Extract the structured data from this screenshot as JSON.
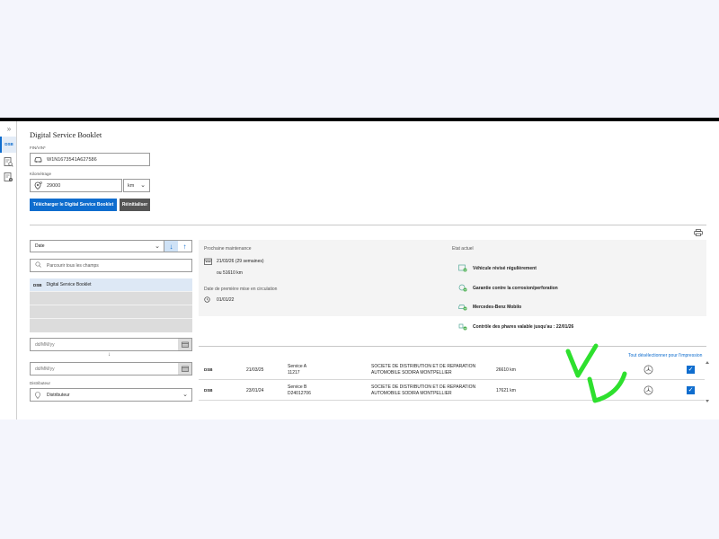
{
  "app": {
    "title": "Digital Service Booklet"
  },
  "rail": {
    "items": [
      {
        "label": "DSB",
        "icon": "dsb-icon"
      },
      {
        "icon": "document-search-icon"
      },
      {
        "icon": "document-settings-icon"
      }
    ]
  },
  "form": {
    "fin_label": "FIN/VIN*",
    "fin_value": "W1N1673541A627586",
    "mileage_label": "Kilométrage",
    "mileage_value": "29000",
    "unit_value": "km",
    "download_label": "Télécharger le Digital Service Booklet",
    "reset_label": "Réinitialiser"
  },
  "filters": {
    "sort_value": "Date",
    "search_placeholder": "Parcourir tous les champs",
    "list": [
      {
        "tag": "DSB",
        "label": "Digital Service Booklet"
      }
    ],
    "date_from_placeholder": "dd/MM/yy",
    "date_to_placeholder": "dd/MM/yy",
    "arrow": "↓",
    "distributor_label": "Distributeur",
    "distributor_value": "Distributeur"
  },
  "info": {
    "next_label": "Prochaine maintenance",
    "next_date": "21/03/26 (29 semaines)",
    "next_km": "ou 51610 km",
    "first_reg_label": "Date de première mise en circulation",
    "first_reg_value": "01/01/22",
    "state_label": "Etat actuel",
    "states": [
      "Véhicule révisé régulièrement",
      "Garantie contre la corrosion/perforation",
      "Mercedes-Benz Mobilo",
      "Contrôle des phares valable jusqu'au : 22/01/26"
    ]
  },
  "table": {
    "deselect_label": "Tout désélectionner pour l'impression",
    "rows": [
      {
        "tag": "DSB",
        "date": "21/03/25",
        "service": "Service A",
        "code": "11217",
        "dealer_1": "SOCIETE DE DISTRIBUTION ET DE REPARATION",
        "dealer_2": "AUTOMOBILE SODIRA MONTPELLIER",
        "km": "26610 km",
        "checked": true
      },
      {
        "tag": "DSB",
        "date": "23/01/24",
        "service": "Service B",
        "code": "D24012706",
        "dealer_1": "SOCIETE DE DISTRIBUTION ET DE REPARATION",
        "dealer_2": "AUTOMOBILE SODIRA MONTPELLIER",
        "km": "17621 km",
        "checked": true
      }
    ]
  },
  "colors": {
    "accent": "#0f6dce",
    "annotation": "#2ee02e"
  }
}
